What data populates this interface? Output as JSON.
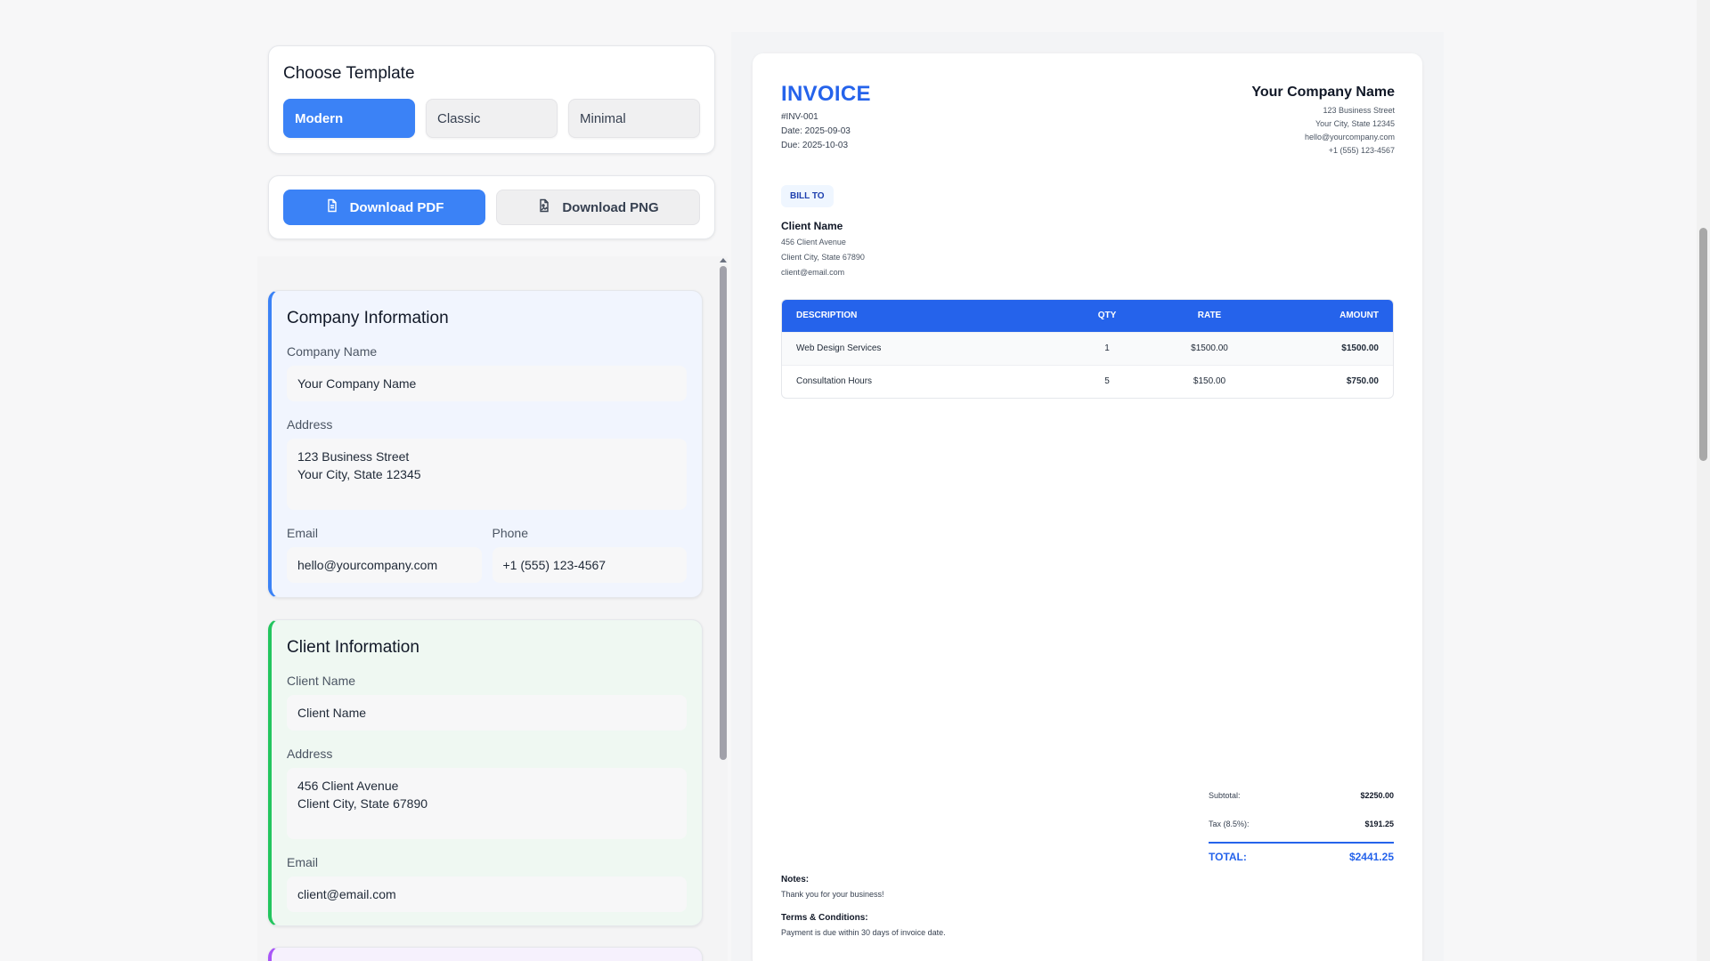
{
  "template": {
    "title": "Choose Template",
    "options": [
      "Modern",
      "Classic",
      "Minimal"
    ],
    "active": "Modern"
  },
  "downloads": {
    "pdf_label": "Download PDF",
    "png_label": "Download PNG"
  },
  "company_section": {
    "title": "Company Information",
    "name_label": "Company Name",
    "name_value": "Your Company Name",
    "address_label": "Address",
    "address_line1": "123 Business Street",
    "address_line2": "Your City, State 12345",
    "email_label": "Email",
    "email_value": "hello@yourcompany.com",
    "phone_label": "Phone",
    "phone_value": "+1 (555) 123-4567"
  },
  "client_section": {
    "title": "Client Information",
    "name_label": "Client Name",
    "name_value": "Client Name",
    "address_label": "Address",
    "address_line1": "456 Client Avenue",
    "address_line2": "Client City, State 67890",
    "email_label": "Email",
    "email_value": "client@email.com"
  },
  "invoice": {
    "title": "INVOICE",
    "number": "#INV-001",
    "date": "Date: 2025-09-03",
    "due": "Due: 2025-10-03",
    "company": {
      "name": "Your Company Name",
      "line1": "123 Business Street",
      "line2": "Your City, State 12345",
      "email": "hello@yourcompany.com",
      "phone": "+1 (555) 123-4567"
    },
    "bill_to_label": "BILL TO",
    "client": {
      "name": "Client Name",
      "line1": "456 Client Avenue",
      "line2": "Client City, State 67890",
      "email": "client@email.com"
    },
    "columns": {
      "description": "DESCRIPTION",
      "qty": "QTY",
      "rate": "RATE",
      "amount": "AMOUNT"
    },
    "items": [
      {
        "description": "Web Design Services",
        "qty": "1",
        "rate": "$1500.00",
        "amount": "$1500.00"
      },
      {
        "description": "Consultation Hours",
        "qty": "5",
        "rate": "$150.00",
        "amount": "$750.00"
      }
    ],
    "subtotal_label": "Subtotal:",
    "subtotal_value": "$2250.00",
    "tax_label": "Tax (8.5%):",
    "tax_value": "$191.25",
    "total_label": "TOTAL:",
    "total_value": "$2441.25",
    "notes_label": "Notes:",
    "notes_text": "Thank you for your business!",
    "terms_label": "Terms & Conditions:",
    "terms_text": "Payment is due within 30 days of invoice date."
  },
  "colors": {
    "accent": "#3b82f6",
    "invoice_blue": "#2563eb",
    "company_bar": "#3b82f6",
    "client_bar": "#22c55e",
    "next_bar": "#a855f7"
  }
}
